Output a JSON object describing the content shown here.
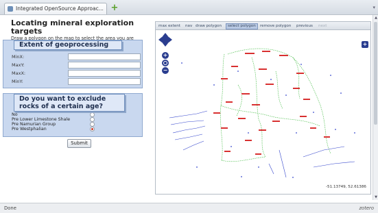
{
  "browser": {
    "tab_title": "Integrated OpenSource Approac...",
    "new_tab_symbol": "+",
    "tab_scroll_symbol": "▾"
  },
  "page": {
    "title": "Locating mineral exploration targets",
    "instructions": "Draw a polygon on the map to select the area you are interested in and then select from the options below."
  },
  "extent": {
    "heading": "Extent of geoprocessing",
    "fields": [
      {
        "label": "MinX:",
        "value": ""
      },
      {
        "label": "MaxY:",
        "value": ""
      },
      {
        "label": "MaxX:",
        "value": ""
      },
      {
        "label": "MinY:",
        "value": ""
      }
    ]
  },
  "exclude": {
    "heading": "Do you want to exclude rocks of a certain age?",
    "options": [
      {
        "label": "No",
        "selected": false
      },
      {
        "label": "Pre Lower Limestone Shale",
        "selected": false
      },
      {
        "label": "Pre Namurian Group",
        "selected": false
      },
      {
        "label": "Pre Westphalian",
        "selected": true
      }
    ]
  },
  "submit_label": "Submit",
  "map": {
    "toolbar": [
      {
        "label": "max extent",
        "active": false,
        "disabled": false
      },
      {
        "label": "nav",
        "active": false,
        "disabled": false
      },
      {
        "label": "draw polygon",
        "active": false,
        "disabled": false
      },
      {
        "label": "select polygon",
        "active": true,
        "disabled": false
      },
      {
        "label": "remove polygon",
        "active": false,
        "disabled": false
      },
      {
        "label": "previous",
        "active": false,
        "disabled": false
      },
      {
        "label": "next",
        "active": false,
        "disabled": true
      }
    ],
    "coordinates": "-51.13749, 52.61386",
    "zoom_in_symbol": "+",
    "zoom_out_symbol": "−",
    "layer_switch_symbol": "+",
    "colors": {
      "boundary_green": "#4fbf4f",
      "feature_blue": "#3344cc",
      "label_red": "#d83030",
      "control_blue": "#2a3d8f"
    }
  },
  "statusbar": {
    "left": "Done",
    "right": "zotero"
  }
}
